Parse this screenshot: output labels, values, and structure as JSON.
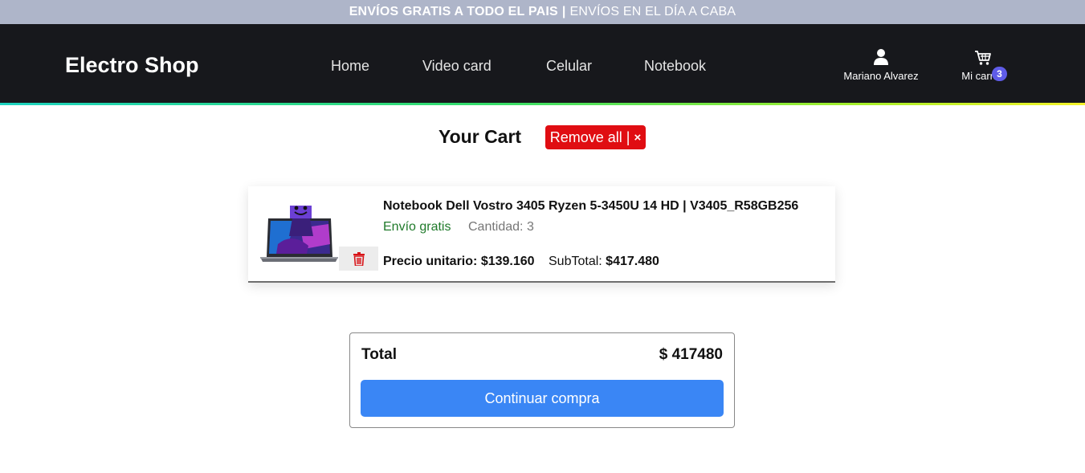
{
  "promo": {
    "bold_text": "ENVÍOS GRATIS A TODO EL PAIS",
    "separator": "|",
    "text": "ENVÍOS EN EL DÍA A CABA"
  },
  "navbar": {
    "brand": "Electro Shop",
    "links": [
      "Home",
      "Video card",
      "Celular",
      "Notebook"
    ],
    "user_name": "Mariano Alvarez",
    "cart_label": "Mi carrito",
    "cart_count": "3",
    "user_icon": "user-icon",
    "cart_icon": "shopping-cart-icon"
  },
  "cart": {
    "title": "Your Cart",
    "remove_all_label": "Remove all |",
    "remove_all_icon": "×"
  },
  "item": {
    "name": "Notebook Dell Vostro 3405 Ryzen 5-3450U 14 HD | V3405_R58GB256",
    "shipping": "Envío gratis",
    "quantity": "Cantidad: 3",
    "unit_price_label": "Precio unitario:",
    "unit_price": "$139.160",
    "subtotal_label": "SubTotal:",
    "subtotal": "$417.480",
    "trash_icon": "trash-icon"
  },
  "summary": {
    "total_label": "Total",
    "total_value": "$ 417480",
    "checkout_label": "Continuar compra"
  },
  "colors": {
    "promo_bg": "#aeb5c9",
    "navbar_bg": "#17181c",
    "remove_red": "#e00d12",
    "badge_purple": "#5f5ce8",
    "shipping_green": "#1f7a2a",
    "checkout_blue": "#3a86f5"
  }
}
